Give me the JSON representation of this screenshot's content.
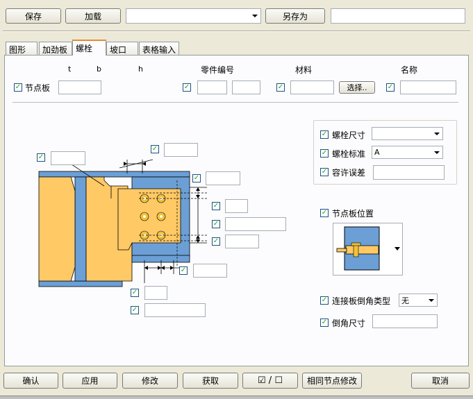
{
  "toolbar": {
    "save": "保存",
    "load": "加载",
    "preset_value": "",
    "save_as": "另存为",
    "save_as_value": ""
  },
  "tabs": [
    "图形",
    "加劲板",
    "螺栓",
    "坡口",
    "表格输入"
  ],
  "active_tab": "螺栓",
  "header_labels": {
    "t": "t",
    "b": "b",
    "h": "h",
    "part_number": "零件编号",
    "material": "材料",
    "name": "名称"
  },
  "gusset": {
    "label": "节点板",
    "t": "",
    "part_prefix": "",
    "part_start": "",
    "material": "",
    "select_button": "选择..",
    "name": ""
  },
  "bolt": {
    "size_label": "螺栓尺寸",
    "size_value": "",
    "standard_label": "螺栓标准",
    "standard_value": "A",
    "tolerance_label": "容许误差",
    "tolerance_value": ""
  },
  "plate_position_label": "节点板位置",
  "chamfer": {
    "type_label": "连接板倒角类型",
    "type_value": "无",
    "size_label": "倒角尺寸",
    "size_value": ""
  },
  "diagram_fields": {
    "top_left": "",
    "top_gap": "",
    "right_top": "",
    "bolt_edge": "",
    "bolt_spacing": "",
    "bolt_bottom": "",
    "bottom_right": "",
    "bottom_a": "",
    "bottom_b": ""
  },
  "bottom_buttons": {
    "ok": "确认",
    "apply": "应用",
    "modify": "修改",
    "get": "获取",
    "toggle": "☑ / ☐",
    "same_node": "相同节点修改",
    "cancel": "取消"
  },
  "colors": {
    "beam_blue": "#6b9fd6",
    "plate_yellow": "#ffc966",
    "bolt_gold": "#f0c23a",
    "check_green": "#21a121"
  },
  "checkmark": "✓"
}
